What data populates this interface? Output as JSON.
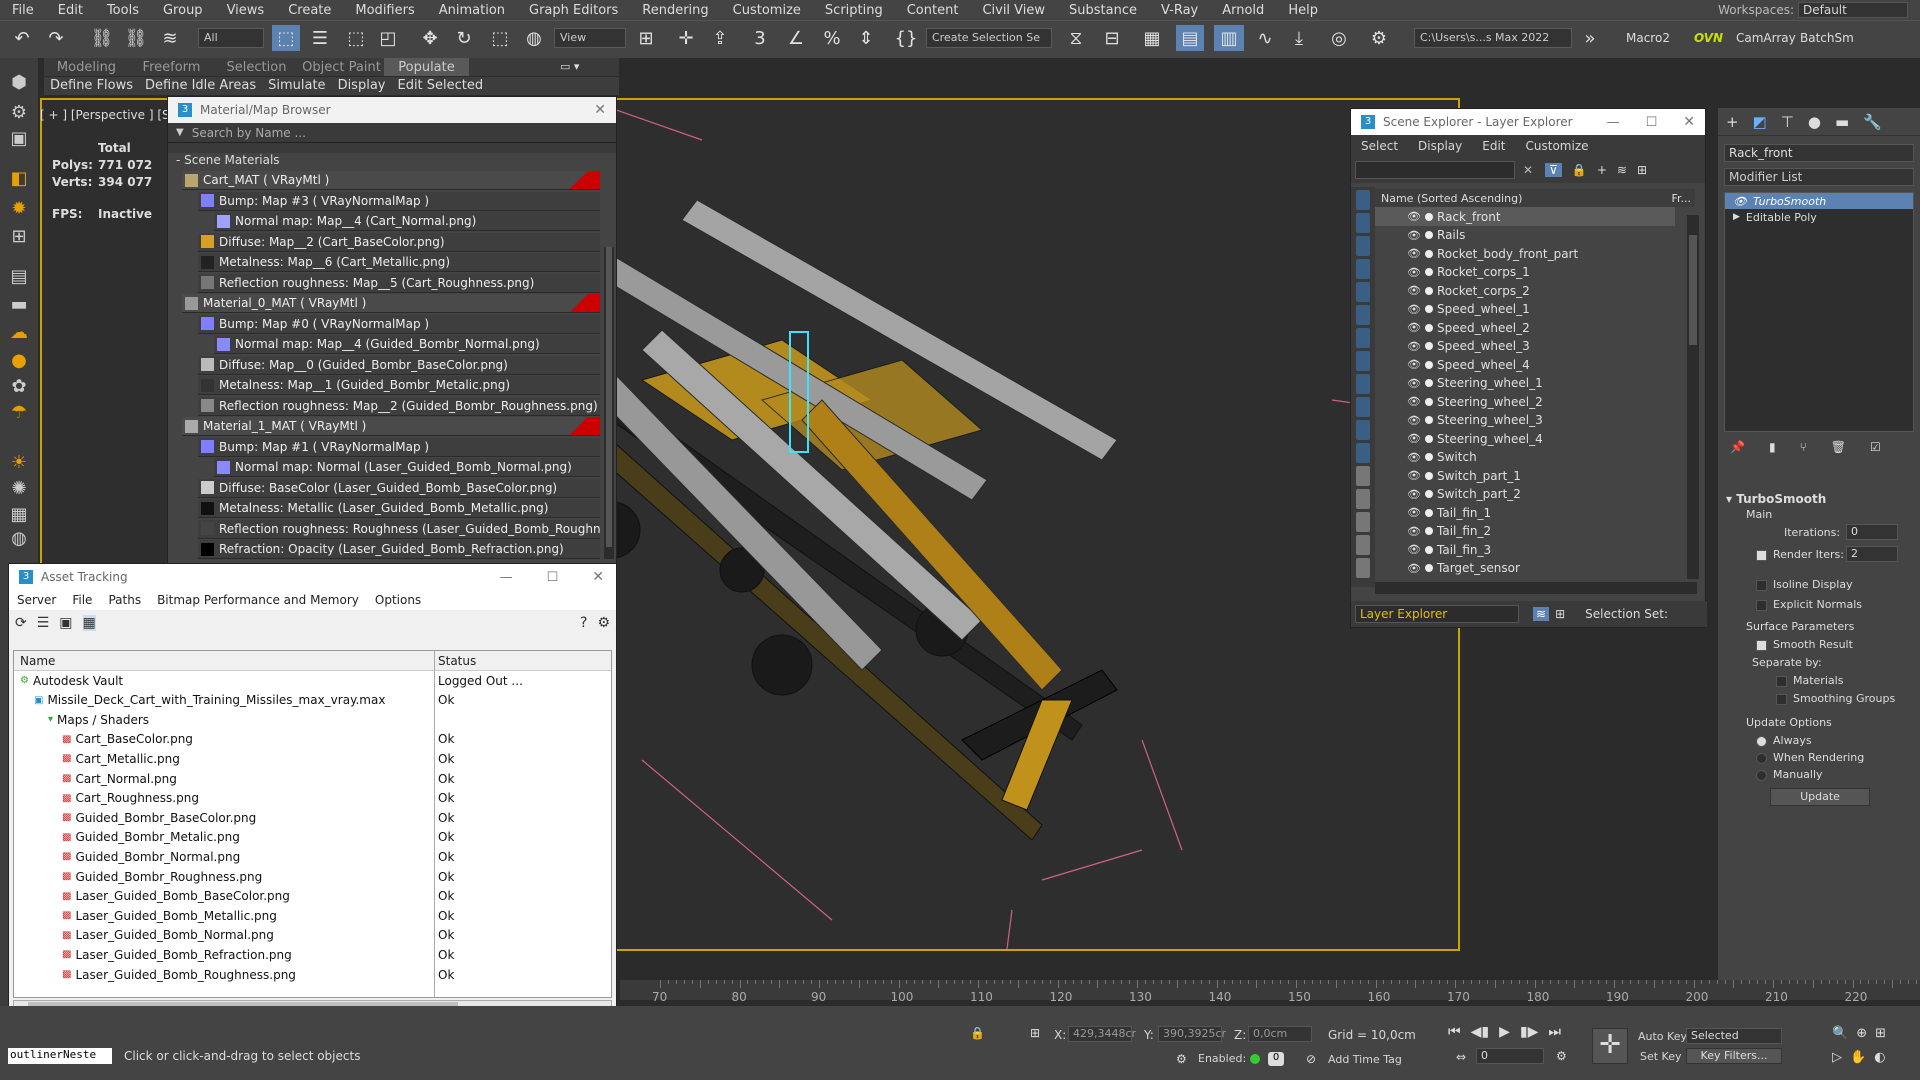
{
  "menu": [
    "File",
    "Edit",
    "Tools",
    "Group",
    "Views",
    "Create",
    "Modifiers",
    "Animation",
    "Graph Editors",
    "Rendering",
    "Customize",
    "Scripting",
    "Content",
    "Civil View",
    "Substance",
    "V-Ray",
    "Arnold",
    "Help"
  ],
  "workspaces_label": "Workspaces:",
  "workspaces_value": "Default",
  "toolbar": {
    "filter": "All",
    "view": "View",
    "selection_set": "Create Selection Se",
    "path": "C:\\Users\\s...s Max 2022",
    "macro": "Macro2",
    "ovn": "OVN",
    "camarray": "CamArray",
    "batchsm": "BatchSm"
  },
  "ribbon_tabs": [
    "Modeling",
    "Freeform",
    "Selection",
    "Object Paint",
    "Populate"
  ],
  "ribbon_sub": [
    "Define Flows",
    "Define Idle Areas",
    "Simulate",
    "Display",
    "Edit Selected"
  ],
  "viewport": {
    "label": "[ + ] [Perspective ] [St",
    "total": "Total",
    "polys_label": "Polys:",
    "polys": "771 072",
    "verts_label": "Verts:",
    "verts": "394 077",
    "fps_label": "FPS:",
    "fps": "Inactive"
  },
  "material_browser": {
    "title": "Material/Map Browser",
    "search": "Search by Name ...",
    "section": "- Scene Materials",
    "rows": [
      {
        "text": "Cart_MAT  ( VRayMtl )",
        "level": 0,
        "swatch": "#b8a870",
        "tag": true
      },
      {
        "text": "Bump: Map #3  ( VRayNormalMap )",
        "level": 1,
        "swatch": "#8080ff",
        "tag": false
      },
      {
        "text": "Normal map: Map__4 (Cart_Normal.png)",
        "level": 2,
        "swatch": "#a0a0ff",
        "tag": false
      },
      {
        "text": "Diffuse: Map__2 (Cart_BaseColor.png)",
        "level": 1,
        "swatch": "#d8a020",
        "tag": false
      },
      {
        "text": "Metalness: Map__6 (Cart_Metallic.png)",
        "level": 1,
        "swatch": "#222",
        "tag": false
      },
      {
        "text": "Reflection roughness: Map__5 (Cart_Roughness.png)",
        "level": 1,
        "swatch": "#777",
        "tag": false
      },
      {
        "text": "Material_0_MAT  ( VRayMtl )",
        "level": 0,
        "swatch": "#999",
        "tag": true
      },
      {
        "text": "Bump: Map #0  ( VRayNormalMap )",
        "level": 1,
        "swatch": "#8080ff",
        "tag": false
      },
      {
        "text": "Normal map: Map__4 (Guided_Bombr_Normal.png)",
        "level": 2,
        "swatch": "#8a8aff",
        "tag": false
      },
      {
        "text": "Diffuse: Map__0 (Guided_Bombr_BaseColor.png)",
        "level": 1,
        "swatch": "#bbb",
        "tag": false
      },
      {
        "text": "Metalness: Map__1 (Guided_Bombr_Metalic.png)",
        "level": 1,
        "swatch": "#333",
        "tag": false
      },
      {
        "text": "Reflection roughness: Map__2 (Guided_Bombr_Roughness.png)",
        "level": 1,
        "swatch": "#888",
        "tag": false
      },
      {
        "text": "Material_1_MAT  ( VRayMtl )",
        "level": 0,
        "swatch": "#aaa",
        "tag": true
      },
      {
        "text": "Bump: Map #1  ( VRayNormalMap )",
        "level": 1,
        "swatch": "#8080ff",
        "tag": false
      },
      {
        "text": "Normal map: Normal (Laser_Guided_Bomb_Normal.png)",
        "level": 2,
        "swatch": "#8a8aff",
        "tag": false
      },
      {
        "text": "Diffuse: BaseColor (Laser_Guided_Bomb_BaseColor.png)",
        "level": 1,
        "swatch": "#ccc",
        "tag": false
      },
      {
        "text": "Metalness: Metallic (Laser_Guided_Bomb_Metallic.png)",
        "level": 1,
        "swatch": "#111",
        "tag": false
      },
      {
        "text": "Reflection roughness: Roughness (Laser_Guided_Bomb_Roughness.png)",
        "level": 1,
        "swatch": "#444",
        "tag": false
      },
      {
        "text": "Refraction: Opacity (Laser_Guided_Bomb_Refraction.png)",
        "level": 1,
        "swatch": "#000",
        "tag": false
      }
    ]
  },
  "asset_tracking": {
    "title": "Asset Tracking",
    "menu": [
      "Server",
      "File",
      "Paths",
      "Bitmap Performance and Memory",
      "Options"
    ],
    "col_name": "Name",
    "col_status": "Status",
    "rows": [
      {
        "name": "Autodesk Vault",
        "status": "Logged Out ...",
        "level": 0
      },
      {
        "name": "Missile_Deck_Cart_with_Training_Missiles_max_vray.max",
        "status": "Ok",
        "level": 1
      },
      {
        "name": "Maps / Shaders",
        "status": "",
        "level": 2
      },
      {
        "name": "Cart_BaseColor.png",
        "status": "Ok",
        "level": 3
      },
      {
        "name": "Cart_Metallic.png",
        "status": "Ok",
        "level": 3
      },
      {
        "name": "Cart_Normal.png",
        "status": "Ok",
        "level": 3
      },
      {
        "name": "Cart_Roughness.png",
        "status": "Ok",
        "level": 3
      },
      {
        "name": "Guided_Bombr_BaseColor.png",
        "status": "Ok",
        "level": 3
      },
      {
        "name": "Guided_Bombr_Metalic.png",
        "status": "Ok",
        "level": 3
      },
      {
        "name": "Guided_Bombr_Normal.png",
        "status": "Ok",
        "level": 3
      },
      {
        "name": "Guided_Bombr_Roughness.png",
        "status": "Ok",
        "level": 3
      },
      {
        "name": "Laser_Guided_Bomb_BaseColor.png",
        "status": "Ok",
        "level": 3
      },
      {
        "name": "Laser_Guided_Bomb_Metallic.png",
        "status": "Ok",
        "level": 3
      },
      {
        "name": "Laser_Guided_Bomb_Normal.png",
        "status": "Ok",
        "level": 3
      },
      {
        "name": "Laser_Guided_Bomb_Refraction.png",
        "status": "Ok",
        "level": 3
      },
      {
        "name": "Laser_Guided_Bomb_Roughness.png",
        "status": "Ok",
        "level": 3
      }
    ]
  },
  "scene_explorer": {
    "title": "Scene Explorer - Layer Explorer",
    "menu": [
      "Select",
      "Display",
      "Edit",
      "Customize"
    ],
    "col": "Name (Sorted Ascending)",
    "col2": "Fr...",
    "items": [
      "Rack_front",
      "Rails",
      "Rocket_body_front_part",
      "Rocket_corps_1",
      "Rocket_corps_2",
      "Speed_wheel_1",
      "Speed_wheel_2",
      "Speed_wheel_3",
      "Speed_wheel_4",
      "Steering_wheel_1",
      "Steering_wheel_2",
      "Steering_wheel_3",
      "Steering_wheel_4",
      "Switch",
      "Switch_part_1",
      "Switch_part_2",
      "Tail_fin_1",
      "Tail_fin_2",
      "Tail_fin_3",
      "Target_sensor"
    ],
    "layer_explorer": "Layer Explorer",
    "selection_set": "Selection Set:"
  },
  "modify_panel": {
    "object_name": "Rack_front",
    "modifier_list": "Modifier List",
    "stack": [
      "TurboSmooth",
      "Editable Poly"
    ],
    "rollout": "TurboSmooth",
    "main": "Main",
    "iterations_label": "Iterations:",
    "iterations": "0",
    "render_iters_label": "Render Iters:",
    "render_iters": "2",
    "isoline": "Isoline Display",
    "explicit": "Explicit Normals",
    "surface": "Surface Parameters",
    "smooth": "Smooth Result",
    "separate": "Separate by:",
    "materials": "Materials",
    "smoothing": "Smoothing Groups",
    "update_options": "Update Options",
    "always": "Always",
    "when_rendering": "When Rendering",
    "manually": "Manually",
    "update": "Update"
  },
  "timeline_ticks": [
    "70",
    "80",
    "90",
    "100",
    "110",
    "120",
    "130",
    "140",
    "150",
    "160",
    "170",
    "180",
    "190",
    "200",
    "210",
    "220"
  ],
  "status": {
    "script": "outlinerNeste",
    "prompt": "Click or click-and-drag to select objects",
    "x_label": "X:",
    "x": "429,3448cr",
    "y_label": "Y:",
    "y": "390,3925cr",
    "z_label": "Z:",
    "z": "0,0cm",
    "grid": "Grid = 10,0cm",
    "enabled": "Enabled:",
    "add_time_tag": "Add Time Tag",
    "auto_key": "Auto Key",
    "selected": "Selected",
    "set_key": "Set Key",
    "key_filters": "Key Filters...",
    "frame": "0"
  }
}
